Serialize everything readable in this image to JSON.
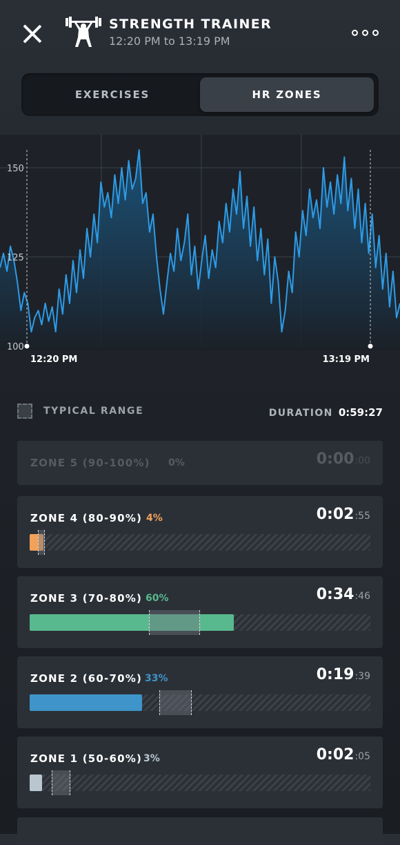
{
  "header": {
    "title": "STRENGTH TRAINER",
    "subtitle": "12:20 PM to 13:19 PM",
    "app_icon": "weightlifter-icon",
    "close_icon": "close-icon",
    "more_icon": "more-dots-icon"
  },
  "tabs": [
    {
      "label": "EXERCISES",
      "selected": false
    },
    {
      "label": "HR ZONES",
      "selected": true
    }
  ],
  "chart_data": {
    "type": "line",
    "title": "",
    "xlabel": "",
    "ylabel": "",
    "ylim": [
      100,
      155
    ],
    "y_ticks": [
      "150",
      "125",
      "100"
    ],
    "x_ticks": [
      "12:20 PM",
      "13:19 PM"
    ],
    "series": [
      {
        "values": [
          122,
          126,
          121,
          128,
          124,
          118,
          110,
          115,
          112,
          104,
          108,
          110,
          106,
          112,
          107,
          111,
          104,
          116,
          109,
          120,
          112,
          124,
          115,
          127,
          119,
          133,
          125,
          137,
          129,
          146,
          139,
          143,
          136,
          148,
          140,
          150,
          141,
          152,
          144,
          147,
          155,
          140,
          143,
          132,
          137,
          125,
          116,
          109,
          118,
          126,
          121,
          133,
          124,
          129,
          137,
          120,
          128,
          116,
          124,
          131,
          119,
          127,
          122,
          135,
          129,
          140,
          132,
          144,
          137,
          149,
          133,
          142,
          128,
          139,
          124,
          133,
          120,
          130,
          112,
          125,
          118,
          104,
          110,
          121,
          115,
          132,
          125,
          138,
          131,
          144,
          136,
          141,
          133,
          150,
          139,
          146,
          137,
          148,
          140,
          153,
          138,
          147,
          133,
          144,
          129,
          140,
          126,
          137,
          122,
          131,
          116,
          126,
          111,
          121,
          108,
          112
        ]
      }
    ],
    "colors": {
      "line": "#2e9be6",
      "fill_top": "#1a5a86",
      "fill_bottom": "#1b2027",
      "grid": "#3b4148"
    }
  },
  "legend": {
    "typical_range_label": "TYPICAL RANGE",
    "duration_label": "DURATION",
    "duration_value": "0:59:27"
  },
  "zones": [
    {
      "name": "ZONE 5 (90-100%)",
      "percent_label": "0%",
      "percent": 0,
      "time_main": "0:00",
      "time_sec": ":00",
      "color": "#555b63",
      "dim": true
    },
    {
      "name": "ZONE 4 (80-90%)",
      "percent_label": "4%",
      "percent": 4,
      "time_main": "0:02",
      "time_sec": ":55",
      "color": "#f2a15a",
      "typical_from": 2.4,
      "typical_to": 4.4
    },
    {
      "name": "ZONE 3 (70-80%)",
      "percent_label": "60%",
      "percent": 60,
      "time_main": "0:34",
      "time_sec": ":46",
      "color": "#58b98f",
      "typical_from": 35,
      "typical_to": 50
    },
    {
      "name": "ZONE 2 (60-70%)",
      "percent_label": "33%",
      "percent": 33,
      "time_main": "0:19",
      "time_sec": ":39",
      "color": "#3f94c9",
      "typical_from": 38,
      "typical_to": 47.5
    },
    {
      "name": "ZONE 1 (50-60%)",
      "percent_label": "3%",
      "percent": 3,
      "time_main": "0:02",
      "time_sec": ":05",
      "color": "#b9c6d0",
      "typical_from": 6.5,
      "typical_to": 12
    }
  ]
}
